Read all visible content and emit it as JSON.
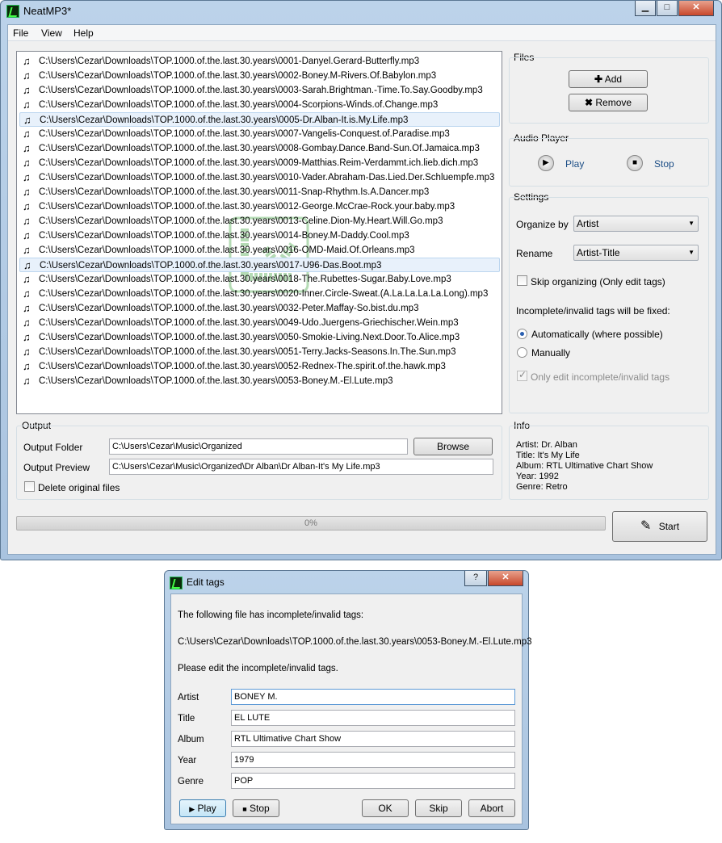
{
  "main_window": {
    "title": "NeatMP3*",
    "caption_buttons": {
      "minimize": "▁",
      "maximize": "□",
      "close": "✕"
    }
  },
  "menu": [
    "File",
    "View",
    "Help"
  ],
  "files": [
    "C:\\Users\\Cezar\\Downloads\\TOP.1000.of.the.last.30.years\\0001-Danyel.Gerard-Butterfly.mp3",
    "C:\\Users\\Cezar\\Downloads\\TOP.1000.of.the.last.30.years\\0002-Boney.M-Rivers.Of.Babylon.mp3",
    "C:\\Users\\Cezar\\Downloads\\TOP.1000.of.the.last.30.years\\0003-Sarah.Brightman.-Time.To.Say.Goodby.mp3",
    "C:\\Users\\Cezar\\Downloads\\TOP.1000.of.the.last.30.years\\0004-Scorpions-Winds.of.Change.mp3",
    "C:\\Users\\Cezar\\Downloads\\TOP.1000.of.the.last.30.years\\0005-Dr.Alban-It.is.My.Life.mp3",
    "C:\\Users\\Cezar\\Downloads\\TOP.1000.of.the.last.30.years\\0007-Vangelis-Conquest.of.Paradise.mp3",
    "C:\\Users\\Cezar\\Downloads\\TOP.1000.of.the.last.30.years\\0008-Gombay.Dance.Band-Sun.Of.Jamaica.mp3",
    "C:\\Users\\Cezar\\Downloads\\TOP.1000.of.the.last.30.years\\0009-Matthias.Reim-Verdammt.ich.lieb.dich.mp3",
    "C:\\Users\\Cezar\\Downloads\\TOP.1000.of.the.last.30.years\\0010-Vader.Abraham-Das.Lied.Der.Schluempfe.mp3",
    "C:\\Users\\Cezar\\Downloads\\TOP.1000.of.the.last.30.years\\0011-Snap-Rhythm.Is.A.Dancer.mp3",
    "C:\\Users\\Cezar\\Downloads\\TOP.1000.of.the.last.30.years\\0012-George.McCrae-Rock.your.baby.mp3",
    "C:\\Users\\Cezar\\Downloads\\TOP.1000.of.the.last.30.years\\0013-Celine.Dion-My.Heart.Will.Go.mp3",
    "C:\\Users\\Cezar\\Downloads\\TOP.1000.of.the.last.30.years\\0014-Boney.M-Daddy.Cool.mp3",
    "C:\\Users\\Cezar\\Downloads\\TOP.1000.of.the.last.30.years\\0016-OMD-Maid.Of.Orleans.mp3",
    "C:\\Users\\Cezar\\Downloads\\TOP.1000.of.the.last.30.years\\0017-U96-Das.Boot.mp3",
    "C:\\Users\\Cezar\\Downloads\\TOP.1000.of.the.last.30.years\\0018-The.Rubettes-Sugar.Baby.Love.mp3",
    "C:\\Users\\Cezar\\Downloads\\TOP.1000.of.the.last.30.years\\0020-Inner.Circle-Sweat.(A.La.La.La.La.Long).mp3",
    "C:\\Users\\Cezar\\Downloads\\TOP.1000.of.the.last.30.years\\0032-Peter.Maffay-So.bist.du.mp3",
    "C:\\Users\\Cezar\\Downloads\\TOP.1000.of.the.last.30.years\\0049-Udo.Juergens-Griechischer.Wein.mp3",
    "C:\\Users\\Cezar\\Downloads\\TOP.1000.of.the.last.30.years\\0050-Smokie-Living.Next.Door.To.Alice.mp3",
    "C:\\Users\\Cezar\\Downloads\\TOP.1000.of.the.last.30.years\\0051-Terry.Jacks-Seasons.In.The.Sun.mp3",
    "C:\\Users\\Cezar\\Downloads\\TOP.1000.of.the.last.30.years\\0052-Rednex-The.spirit.of.the.hawk.mp3",
    "C:\\Users\\Cezar\\Downloads\\TOP.1000.of.the.last.30.years\\0053-Boney.M.-El.Lute.mp3"
  ],
  "files_panel": {
    "label": "Files",
    "add": "Add",
    "remove": "Remove"
  },
  "audio_player": {
    "label": "Audio Player",
    "play": "Play",
    "stop": "Stop"
  },
  "settings": {
    "label": "Settings",
    "organize_by_label": "Organize by",
    "organize_by_value": "Artist",
    "rename_label": "Rename",
    "rename_value": "Artist-Title",
    "skip_organizing": "Skip organizing (Only edit tags)",
    "skip_organizing_checked": false,
    "fix_heading": "Incomplete/invalid tags will be fixed:",
    "auto": "Automatically (where possible)",
    "manual": "Manually",
    "selected_fix_mode": "auto",
    "only_edit": "Only edit incomplete/invalid tags",
    "only_edit_checked": true
  },
  "output": {
    "label": "Output",
    "folder_label": "Output Folder",
    "folder_value": "C:\\Users\\Cezar\\Music\\Organized",
    "browse": "Browse",
    "preview_label": "Output Preview",
    "preview_value": "C:\\Users\\Cezar\\Music\\Organized\\Dr  Alban\\Dr  Alban-It's My Life.mp3",
    "delete_original": "Delete original files",
    "delete_original_checked": false
  },
  "info": {
    "label": "Info",
    "artist": "Artist: Dr. Alban",
    "title": "Title: It's My Life",
    "album": "Album: RTL Ultimative Chart Show",
    "year": "Year: 1992",
    "genre": "Genre: Retro"
  },
  "progress": {
    "text": "0%",
    "value": 0
  },
  "start": "Start",
  "dialog": {
    "title": "Edit tags",
    "help": "?",
    "close": "✕",
    "message": "The following file has incomplete/invalid tags:",
    "path": "C:\\Users\\Cezar\\Downloads\\TOP.1000.of.the.last.30.years\\0053-Boney.M.-El.Lute.mp3",
    "instruction": "Please edit the incomplete/invalid tags.",
    "fields": {
      "artist_label": "Artist",
      "artist_value": "BONEY M.",
      "title_label": "Title",
      "title_value": "EL LUTE",
      "album_label": "Album",
      "album_value": "RTL Ultimative Chart Show",
      "year_label": "Year",
      "year_value": "1979",
      "genre_label": "Genre",
      "genre_value": "POP"
    },
    "play": "Play",
    "stop": "Stop",
    "ok": "OK",
    "skip": "Skip",
    "abort": "Abort"
  }
}
